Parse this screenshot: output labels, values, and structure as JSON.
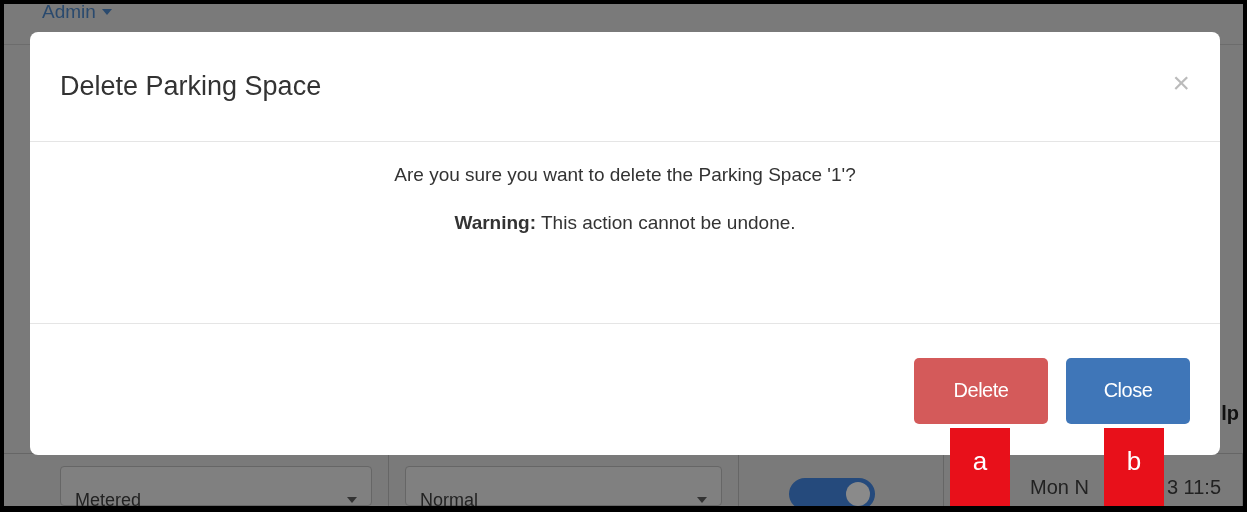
{
  "page": {
    "user_menu": "Admin",
    "row": {
      "type_select": "Metered",
      "status_select": "Normal",
      "toggle": {
        "on": true
      },
      "time_parts": [
        "Mon N",
        "3 11:5"
      ],
      "right_text": "lp"
    }
  },
  "modal": {
    "title": "Delete Parking Space",
    "close_symbol": "×",
    "message": "Are you sure you want to delete the Parking Space '1'?",
    "warning": "**Warning:** This action cannot be undone.",
    "buttons": [
      {
        "label": "Delete",
        "kind": "danger"
      },
      {
        "label": "Close",
        "kind": "primary"
      }
    ]
  },
  "callouts": [
    "a",
    "b"
  ]
}
